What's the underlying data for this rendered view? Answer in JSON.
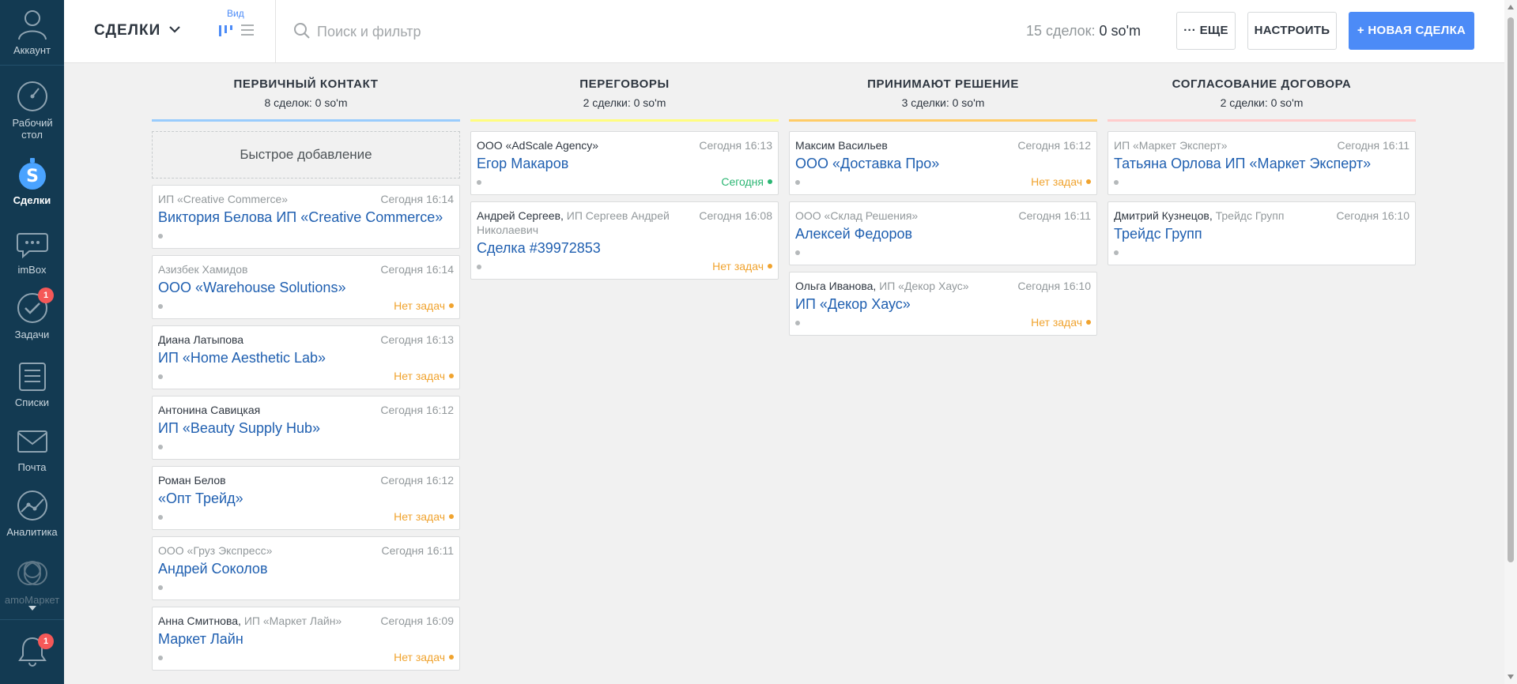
{
  "sidebar": {
    "items": [
      {
        "label": "Аккаунт",
        "icon": "user-avatar-icon"
      },
      {
        "label": "Рабочий стол",
        "icon": "speedometer-icon"
      },
      {
        "label": "Сделки",
        "icon": "deals-icon",
        "active": true
      },
      {
        "label": "imBox",
        "icon": "chat-bubble-icon"
      },
      {
        "label": "Задачи",
        "icon": "checkmark-circle-icon",
        "badge": "1"
      },
      {
        "label": "Списки",
        "icon": "list-icon"
      },
      {
        "label": "Почта",
        "icon": "envelope-icon"
      },
      {
        "label": "Аналитика",
        "icon": "analytics-icon"
      },
      {
        "label": "amoМаркет",
        "icon": "market-icon"
      }
    ],
    "notifications_badge": "1"
  },
  "topbar": {
    "pipeline_title": "СДЕЛКИ",
    "view_label": "Вид",
    "search_placeholder": "Поиск и фильтр",
    "deal_count": "15 сделок:",
    "deal_amount": "0 so'm",
    "more_label": "ЕЩЕ",
    "setup_label": "НАСТРОИТЬ",
    "new_deal_label": "+ НОВАЯ СДЕЛКА"
  },
  "colors": {
    "sidebar_bg": "#133a52",
    "accent_blue": "#4c8bf7",
    "link_blue": "#1f5fb0",
    "no_tasks": "#f0a32e",
    "today": "#2bb673"
  },
  "columns": [
    {
      "title": "ПЕРВИЧНЫЙ КОНТАКТ",
      "subtitle": "8 сделок: 0 so'm",
      "color": "#99ccfd",
      "quick_add": "Быстрое добавление",
      "cards": [
        {
          "contact": "",
          "company": "ИП «Creative Commerce»",
          "time": "Сегодня 16:14",
          "name": "Виктория Белова ИП «Creative Commerce»",
          "status": ""
        },
        {
          "contact": "",
          "company": "Азизбек Хамидов",
          "time": "Сегодня 16:14",
          "name": "ООО «Warehouse Solutions»",
          "status": "Нет задач"
        },
        {
          "contact": "Диана Латыпова",
          "company": "",
          "time": "Сегодня 16:13",
          "name": "ИП «Home Aesthetic Lab»",
          "status": "Нет задач"
        },
        {
          "contact": "Антонина Савицкая",
          "company": "",
          "time": "Сегодня 16:12",
          "name": "ИП «Beauty Supply Hub»",
          "status": ""
        },
        {
          "contact": "Роман Белов",
          "company": "",
          "time": "Сегодня 16:12",
          "name": "«Опт Трейд»",
          "status": "Нет задач"
        },
        {
          "contact": "",
          "company": "ООО «Груз Экспресс»",
          "time": "Сегодня 16:11",
          "name": "Андрей Соколов",
          "status": ""
        },
        {
          "contact": "Анна Смитнова,",
          "company": "ИП «Маркет Лайн»",
          "time": "Сегодня 16:09",
          "name": "Маркет Лайн",
          "status": "Нет задач"
        }
      ]
    },
    {
      "title": "ПЕРЕГОВОРЫ",
      "subtitle": "2 сделки: 0 so'm",
      "color": "#fffd7f",
      "cards": [
        {
          "contact": "ООО «AdScale Agency»",
          "company": "",
          "time": "Сегодня 16:13",
          "name": "Егор Макаров",
          "status": "Сегодня"
        },
        {
          "contact": "Андрей Сергеев,",
          "company": "ИП Сергеев Андрей Николаевич",
          "time": "Сегодня 16:08",
          "name": "Сделка #39972853",
          "status": "Нет задач"
        }
      ]
    },
    {
      "title": "ПРИНИМАЮТ РЕШЕНИЕ",
      "subtitle": "3 сделки: 0 so'm",
      "color": "#ffcc66",
      "cards": [
        {
          "contact": "Максим Васильев",
          "company": "",
          "time": "Сегодня 16:12",
          "name": "ООО «Доставка Про»",
          "status": "Нет задач"
        },
        {
          "contact": "",
          "company": "ООО «Склад Решения»",
          "time": "Сегодня 16:11",
          "name": "Алексей Федоров",
          "status": ""
        },
        {
          "contact": "Ольга Иванова,",
          "company": "ИП «Декор Хаус»",
          "time": "Сегодня 16:10",
          "name": "ИП «Декор Хаус»",
          "status": "Нет задач"
        }
      ]
    },
    {
      "title": "СОГЛАСОВАНИЕ ДОГОВОРА",
      "subtitle": "2 сделки: 0 so'm",
      "color": "#ffcccc",
      "cards": [
        {
          "contact": "",
          "company": "ИП «Маркет Эксперт»",
          "time": "Сегодня 16:11",
          "name": "Татьяна Орлова ИП «Маркет Эксперт»",
          "status": ""
        },
        {
          "contact": "Дмитрий Кузнецов,",
          "company": "Трейдс Групп",
          "time": "Сегодня 16:10",
          "name": "Трейдс Групп",
          "status": ""
        }
      ]
    }
  ]
}
